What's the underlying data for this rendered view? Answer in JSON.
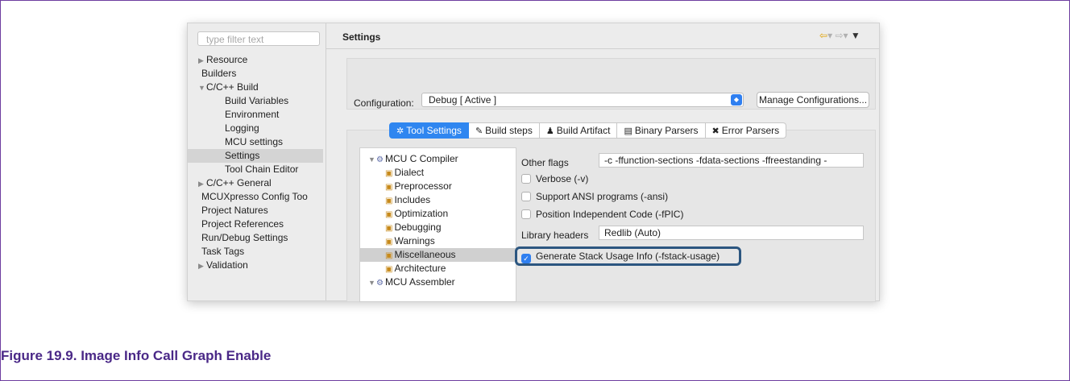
{
  "filter": {
    "placeholder": "type filter text"
  },
  "left_nav": [
    {
      "label": "Resource",
      "arrow": "▶",
      "indent": 0
    },
    {
      "label": "Builders",
      "arrow": "",
      "indent": 0
    },
    {
      "label": "C/C++ Build",
      "arrow": "▼",
      "indent": 0
    },
    {
      "label": "Build Variables",
      "arrow": "",
      "indent": 1
    },
    {
      "label": "Environment",
      "arrow": "",
      "indent": 1
    },
    {
      "label": "Logging",
      "arrow": "",
      "indent": 1
    },
    {
      "label": "MCU settings",
      "arrow": "",
      "indent": 1
    },
    {
      "label": "Settings",
      "arrow": "",
      "indent": 1,
      "selected": true
    },
    {
      "label": "Tool Chain Editor",
      "arrow": "",
      "indent": 1
    },
    {
      "label": "C/C++ General",
      "arrow": "▶",
      "indent": 0
    },
    {
      "label": "MCUXpresso Config Too",
      "arrow": "",
      "indent": 0
    },
    {
      "label": "Project Natures",
      "arrow": "",
      "indent": 0
    },
    {
      "label": "Project References",
      "arrow": "",
      "indent": 0
    },
    {
      "label": "Run/Debug Settings",
      "arrow": "",
      "indent": 0
    },
    {
      "label": "Task Tags",
      "arrow": "",
      "indent": 0
    },
    {
      "label": "Validation",
      "arrow": "▶",
      "indent": 0
    }
  ],
  "header": {
    "title": "Settings"
  },
  "config": {
    "label": "Configuration:",
    "value": "Debug  [ Active ]",
    "manage_button": "Manage Configurations..."
  },
  "tabs": [
    {
      "label": "Tool Settings",
      "icon": "✲",
      "active": true
    },
    {
      "label": "Build steps",
      "icon": "✎"
    },
    {
      "label": "Build Artifact",
      "icon": "♟"
    },
    {
      "label": "Binary Parsers",
      "icon": "▤"
    },
    {
      "label": "Error Parsers",
      "icon": "✖"
    }
  ],
  "tool_tree": [
    {
      "label": "MCU C Compiler",
      "type": "group"
    },
    {
      "label": "Dialect",
      "type": "child"
    },
    {
      "label": "Preprocessor",
      "type": "child"
    },
    {
      "label": "Includes",
      "type": "child"
    },
    {
      "label": "Optimization",
      "type": "child"
    },
    {
      "label": "Debugging",
      "type": "child"
    },
    {
      "label": "Warnings",
      "type": "child"
    },
    {
      "label": "Miscellaneous",
      "type": "child",
      "selected": true
    },
    {
      "label": "Architecture",
      "type": "child"
    },
    {
      "label": "MCU Assembler",
      "type": "group"
    }
  ],
  "options": {
    "other_flags_label": "Other flags",
    "other_flags_value": "-c  -ffunction-sections  -fdata-sections  -ffreestanding  -",
    "verbose": {
      "label": "Verbose (-v)",
      "checked": false
    },
    "ansi": {
      "label": "Support ANSI programs (-ansi)",
      "checked": false
    },
    "pic": {
      "label": "Position Independent Code (-fPIC)",
      "checked": false
    },
    "library_headers_label": "Library headers",
    "library_headers_value": "Redlib (Auto)",
    "stack_usage": {
      "label": "Generate Stack Usage Info (-fstack-usage)",
      "checked": true
    }
  },
  "caption": "Figure 19.9. Image Info Call Graph Enable"
}
